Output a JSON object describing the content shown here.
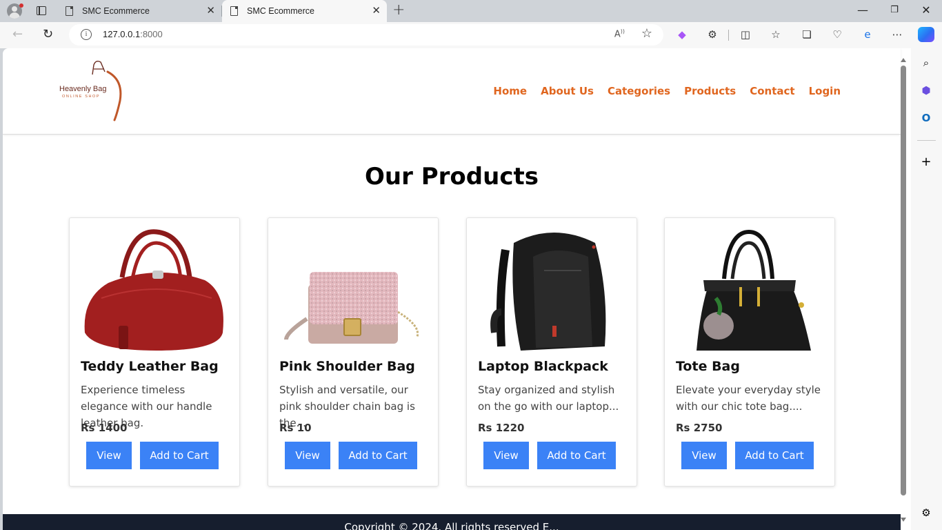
{
  "browser": {
    "tabs": [
      {
        "title": "SMC Ecommerce",
        "active": false
      },
      {
        "title": "SMC Ecommerce",
        "active": true
      }
    ],
    "new_tab_icon": "plus-icon",
    "url_host": "127.0.0.1",
    "url_port": ":8000",
    "read_aloud_label": "A̅",
    "window_controls": [
      "minimize-icon",
      "restore-icon",
      "close-icon"
    ]
  },
  "site": {
    "brand_name": "Heavenly Bag",
    "brand_tagline": "ONLINE SHOP",
    "nav": [
      "Home",
      "About Us",
      "Categories",
      "Products",
      "Contact",
      "Login"
    ],
    "nav_color": "#e0661f"
  },
  "main": {
    "heading": "Our Products",
    "button_color": "#3b82f6",
    "products": [
      {
        "name": "Teddy Leather Bag",
        "description": "Experience timeless elegance with our handle leather bag.",
        "price": "Rs 1400",
        "view": "View",
        "cart": "Add to Cart",
        "image": "red-leather-handbag"
      },
      {
        "name": "Pink Shoulder Bag",
        "description": "Stylish and versatile, our pink shoulder chain bag is the...",
        "price": "Rs 10",
        "view": "View",
        "cart": "Add to Cart",
        "image": "pink-glitter-shoulder-bag"
      },
      {
        "name": "Laptop Blackpack",
        "description": "Stay organized and stylish on the go with our laptop...",
        "price": "Rs 1220",
        "view": "View",
        "cart": "Add to Cart",
        "image": "black-laptop-backpack"
      },
      {
        "name": "Tote Bag",
        "description": "Elevate your everyday style with our chic tote bag....",
        "price": "Rs 2750",
        "view": "View",
        "cart": "Add to Cart",
        "image": "black-tote-bag"
      }
    ]
  },
  "footer": {
    "copyright": "Copyright © 2024. All rights reserved E..."
  }
}
